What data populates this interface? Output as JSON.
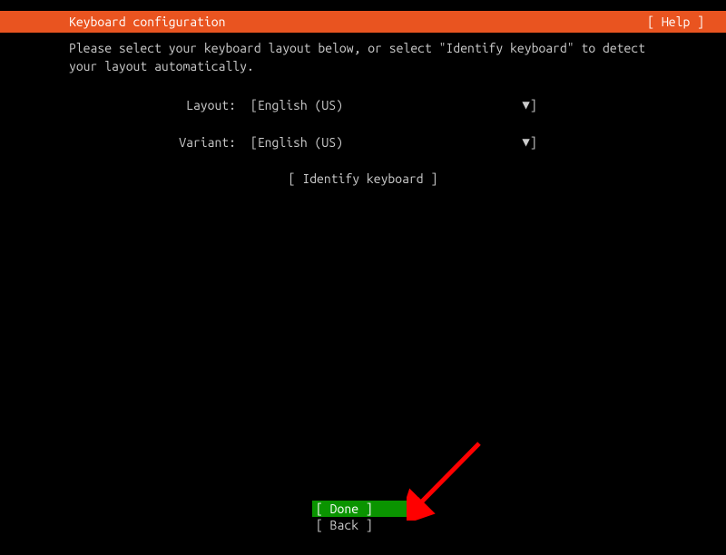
{
  "header": {
    "title": "Keyboard configuration",
    "help": "[ Help ]"
  },
  "instruction": "Please select your keyboard layout below, or select \"Identify keyboard\" to detect your layout automatically.",
  "fields": {
    "layout": {
      "label": "Layout:",
      "value": "English (US)"
    },
    "variant": {
      "label": "Variant:",
      "value": "English (US)"
    }
  },
  "identify_button": "[ Identify keyboard ]",
  "footer": {
    "done": "[ Done        ]",
    "back": "[ Back        ]"
  },
  "colors": {
    "header_bg": "#E95420",
    "done_bg": "#0a9400"
  }
}
